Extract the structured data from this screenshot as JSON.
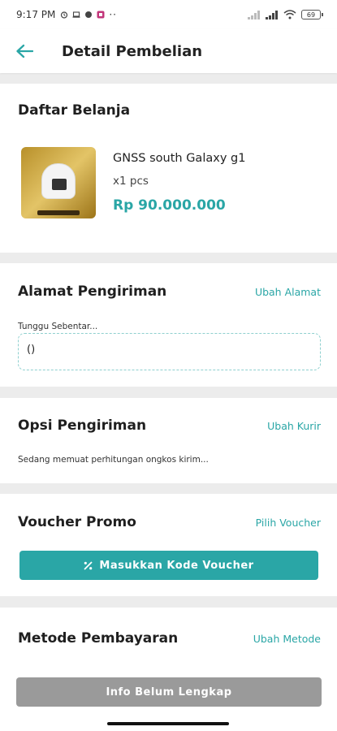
{
  "status_bar": {
    "time": "9:17 PM",
    "battery": "69",
    "icons_left": [
      "alarm-icon",
      "laptop-icon",
      "chat-icon",
      "app-icon",
      "more-dots-icon"
    ],
    "icons_right": [
      "signal-icon",
      "signal-icon",
      "wifi-icon",
      "battery-icon"
    ]
  },
  "header": {
    "title": "Detail Pembelian",
    "back_icon": "arrow-left-icon"
  },
  "cart": {
    "title": "Daftar Belanja",
    "product": {
      "name": "GNSS south Galaxy g1",
      "qty": "x1 pcs",
      "price": "Rp 90.000.000"
    }
  },
  "address": {
    "title": "Alamat Pengiriman",
    "link": "Ubah Alamat",
    "status": "Tunggu Sebentar...",
    "value": "()"
  },
  "shipping": {
    "title": "Opsi Pengiriman",
    "link": "Ubah Kurir",
    "note": "Sedang memuat perhitungan ongkos kirim..."
  },
  "voucher": {
    "title": "Voucher Promo",
    "link": "Pilih Voucher",
    "button_label": "Masukkan Kode Voucher",
    "button_icon": "percent-icon"
  },
  "payment": {
    "title": "Metode Pembayaran",
    "link": "Ubah Metode"
  },
  "footer": {
    "button_label": "Info Belum Lengkap"
  },
  "colors": {
    "accent": "#2aa6a6",
    "disabled_button": "#9a9a9a",
    "background": "#ececec"
  }
}
